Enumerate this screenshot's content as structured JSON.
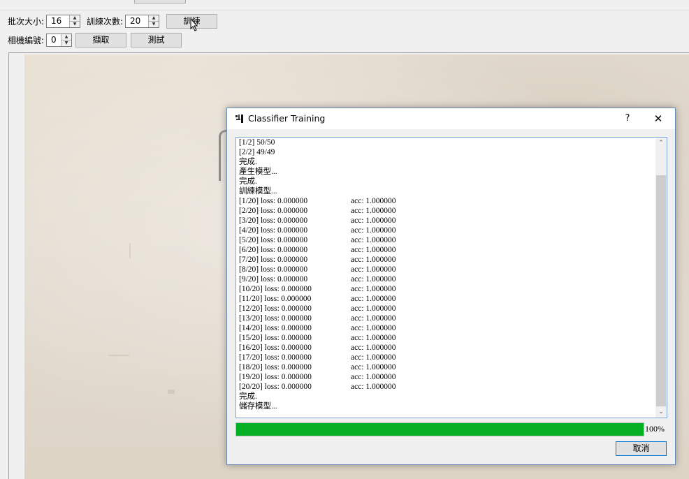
{
  "toolbar": {
    "batch_size_label": "批次大小:",
    "batch_size_value": "16",
    "epochs_label": "訓練次數:",
    "epochs_value": "20",
    "train_button": "訓練",
    "camera_id_label": "相機編號:",
    "camera_id_value": "0",
    "capture_button": "擷取",
    "test_button": "測試"
  },
  "dialog": {
    "title": "Classifier Training",
    "help": "?",
    "close": "✕",
    "log_lines": [
      {
        "text": "[1/2] 50/50",
        "acc": ""
      },
      {
        "text": "[2/2] 49/49",
        "acc": ""
      },
      {
        "text": "完成.",
        "acc": ""
      },
      {
        "text": "產生模型...",
        "acc": ""
      },
      {
        "text": "完成.",
        "acc": ""
      },
      {
        "text": "訓練模型...",
        "acc": ""
      },
      {
        "text": "[1/20] loss: 0.000000",
        "acc": "acc: 1.000000"
      },
      {
        "text": "[2/20] loss: 0.000000",
        "acc": "acc: 1.000000"
      },
      {
        "text": "[3/20] loss: 0.000000",
        "acc": "acc: 1.000000"
      },
      {
        "text": "[4/20] loss: 0.000000",
        "acc": "acc: 1.000000"
      },
      {
        "text": "[5/20] loss: 0.000000",
        "acc": "acc: 1.000000"
      },
      {
        "text": "[6/20] loss: 0.000000",
        "acc": "acc: 1.000000"
      },
      {
        "text": "[7/20] loss: 0.000000",
        "acc": "acc: 1.000000"
      },
      {
        "text": "[8/20] loss: 0.000000",
        "acc": "acc: 1.000000"
      },
      {
        "text": "[9/20] loss: 0.000000",
        "acc": "acc: 1.000000"
      },
      {
        "text": "[10/20] loss: 0.000000",
        "acc": "acc: 1.000000"
      },
      {
        "text": "[11/20] loss: 0.000000",
        "acc": "acc: 1.000000"
      },
      {
        "text": "[12/20] loss: 0.000000",
        "acc": "acc: 1.000000"
      },
      {
        "text": "[13/20] loss: 0.000000",
        "acc": "acc: 1.000000"
      },
      {
        "text": "[14/20] loss: 0.000000",
        "acc": "acc: 1.000000"
      },
      {
        "text": "[15/20] loss: 0.000000",
        "acc": "acc: 1.000000"
      },
      {
        "text": "[16/20] loss: 0.000000",
        "acc": "acc: 1.000000"
      },
      {
        "text": "[17/20] loss: 0.000000",
        "acc": "acc: 1.000000"
      },
      {
        "text": "[18/20] loss: 0.000000",
        "acc": "acc: 1.000000"
      },
      {
        "text": "[19/20] loss: 0.000000",
        "acc": "acc: 1.000000"
      },
      {
        "text": "[20/20] loss: 0.000000",
        "acc": "acc: 1.000000"
      },
      {
        "text": "完成.",
        "acc": ""
      },
      {
        "text": "儲存模型...",
        "acc": ""
      }
    ],
    "progress_fraction": 1.0,
    "progress_text": "100%",
    "progress_color": "#06b025",
    "cancel_button": "取消"
  },
  "icons": {
    "app": "pen-app-icon",
    "spin_up": "▲",
    "spin_down": "▼",
    "scroll_up": "⌃",
    "scroll_down": "⌄"
  }
}
